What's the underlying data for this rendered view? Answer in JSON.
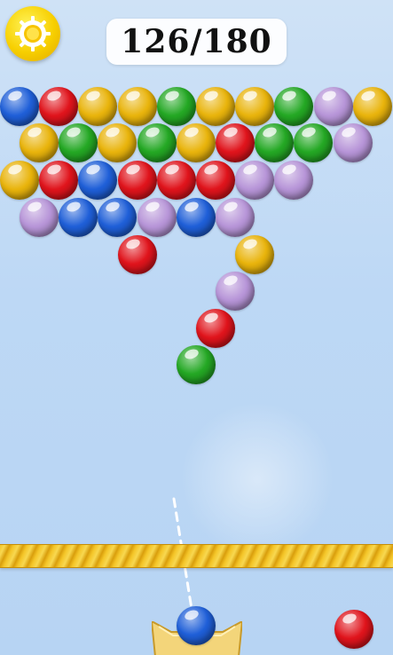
{
  "hud": {
    "score_text": "126/180",
    "settings_icon": "sun-gear-icon"
  },
  "colors": {
    "background_top": "#cfe2f6",
    "background_bottom": "#b7d4f3",
    "blue": "#1f5fd8",
    "red": "#e0141c",
    "yellow": "#e9b40c",
    "green": "#24a824",
    "purple": "#b795d8",
    "rope": "#f4c528"
  },
  "board": {
    "balls": [
      {
        "color": "blue"
      },
      {
        "color": "red"
      },
      {
        "color": "yellow"
      },
      {
        "color": "yellow"
      },
      {
        "color": "green"
      },
      {
        "color": "yellow"
      },
      {
        "color": "yellow"
      },
      {
        "color": "green"
      },
      {
        "color": "purple"
      },
      {
        "color": "yellow"
      },
      {
        "color": "yellow"
      },
      {
        "color": "green"
      },
      {
        "color": "yellow"
      },
      {
        "color": "green"
      },
      {
        "color": "yellow"
      },
      {
        "color": "red"
      },
      {
        "color": "green"
      },
      {
        "color": "green"
      },
      {
        "color": "purple"
      },
      {
        "color": "yellow"
      },
      {
        "color": "red"
      },
      {
        "color": "blue"
      },
      {
        "color": "red"
      },
      {
        "color": "red"
      },
      {
        "color": "red"
      },
      {
        "color": "purple"
      },
      {
        "color": "purple"
      },
      {
        "color": "purple"
      },
      {
        "color": "blue"
      },
      {
        "color": "blue"
      },
      {
        "color": "purple"
      },
      {
        "color": "blue"
      },
      {
        "color": "purple"
      },
      {
        "color": "red"
      },
      {
        "color": "yellow"
      },
      {
        "color": "purple"
      },
      {
        "color": "red"
      },
      {
        "color": "green"
      }
    ]
  },
  "shooter": {
    "current_ball": "blue",
    "next_ball": "red"
  }
}
